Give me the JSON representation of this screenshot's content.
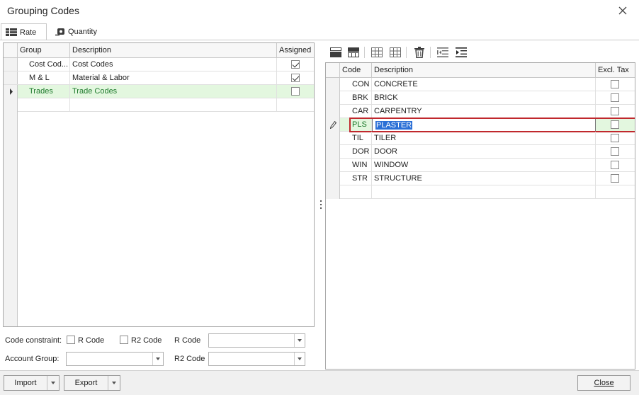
{
  "window": {
    "title": "Grouping Codes"
  },
  "tabs": [
    {
      "label": "Rate",
      "active": true,
      "icon": "table-grid-icon"
    },
    {
      "label": "Quantity",
      "active": false,
      "icon": "tape-measure-icon"
    }
  ],
  "group_grid": {
    "columns": [
      "Group",
      "Description",
      "Assigned"
    ],
    "rows": [
      {
        "group": "Cost Cod...",
        "description": "Cost Codes",
        "assigned": true,
        "selected": false
      },
      {
        "group": "M & L",
        "description": "Material & Labor",
        "assigned": true,
        "selected": false
      },
      {
        "group": "Trades",
        "description": "Trade Codes",
        "assigned": false,
        "selected": true
      }
    ]
  },
  "code_toolbar": {
    "icons": [
      "insert-row-above-icon",
      "insert-row-below-icon",
      "table-icon",
      "table-add-icon",
      "delete-icon",
      "outdent-icon",
      "indent-icon"
    ]
  },
  "code_grid": {
    "columns": [
      "Code",
      "Description",
      "Excl. Tax"
    ],
    "rows": [
      {
        "code": "CON",
        "description": "CONCRETE",
        "excl_tax": false
      },
      {
        "code": "BRK",
        "description": "BRICK",
        "excl_tax": false
      },
      {
        "code": "CAR",
        "description": "CARPENTRY",
        "excl_tax": false
      },
      {
        "code": "PLS",
        "description": "PLASTER",
        "excl_tax": false,
        "editing": true
      },
      {
        "code": "TIL",
        "description": "TILER",
        "excl_tax": false
      },
      {
        "code": "DOR",
        "description": "DOOR",
        "excl_tax": false
      },
      {
        "code": "WIN",
        "description": "WINDOW",
        "excl_tax": false
      },
      {
        "code": "STR",
        "description": "STRUCTURE",
        "excl_tax": false
      }
    ]
  },
  "filters": {
    "code_constraint_label": "Code constraint:",
    "r_code_check_label": "R Code",
    "r2_code_check_label": "R2 Code",
    "r_code_label": "R Code",
    "r2_code_label": "R2 Code",
    "account_group_label": "Account Group:",
    "r_code_value": "",
    "r2_code_value": "",
    "account_group_value": ""
  },
  "buttons": {
    "import": "Import",
    "export": "Export",
    "close": "Close"
  },
  "colors": {
    "selected_row_bg": "#e3f7df",
    "selected_row_text": "#1e7a2c",
    "highlight_border": "#c0282d",
    "edit_selection_bg": "#2b6fd6"
  }
}
